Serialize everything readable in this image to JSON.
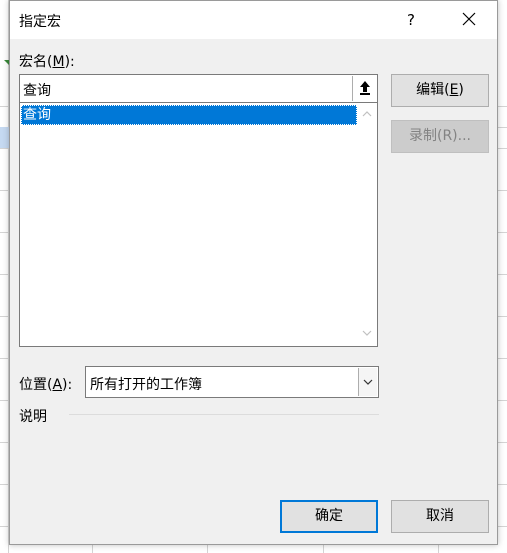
{
  "dialog": {
    "title": "指定宏",
    "help_label": "?"
  },
  "macro_name": {
    "label_prefix": "宏名(",
    "label_key": "M",
    "label_suffix": "):",
    "value": "查询",
    "upload_icon": "collapse-upload-icon"
  },
  "macro_list": {
    "items": [
      "查询"
    ],
    "selected_index": 0
  },
  "buttons": {
    "edit_prefix": "编辑(",
    "edit_key": "E",
    "edit_suffix": ")",
    "record_label": "录制(R)...",
    "ok_label": "确定",
    "cancel_label": "取消"
  },
  "location": {
    "label_prefix": "位置(",
    "label_key": "A",
    "label_suffix": "):",
    "selected": "所有打开的工作簿"
  },
  "description": {
    "label": "说明"
  },
  "colors": {
    "selection": "#0078d7",
    "dialog_bg": "#f0f0f0",
    "default_border": "#0078d7"
  }
}
